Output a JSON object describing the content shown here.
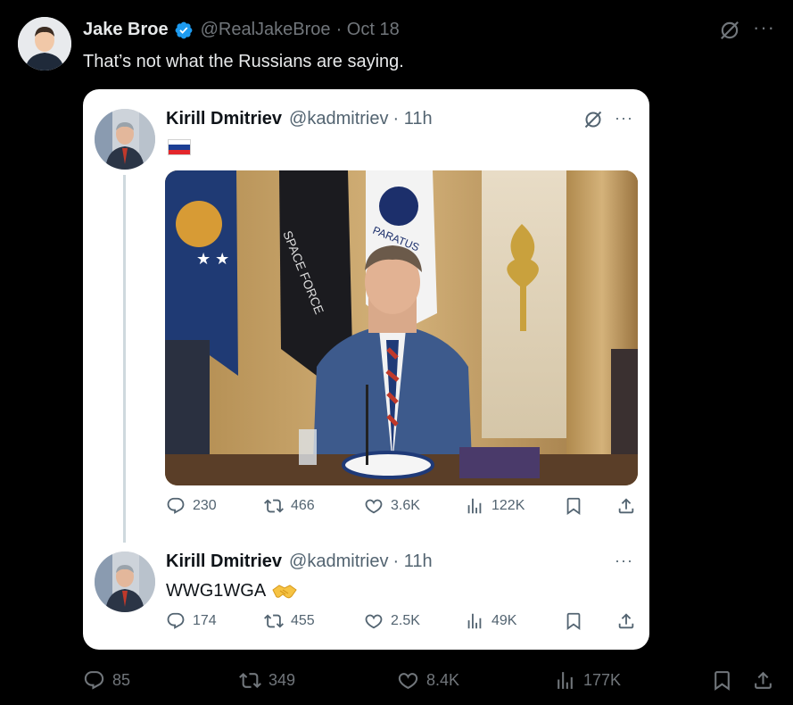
{
  "post": {
    "author_name": "Jake Broe",
    "handle": "@RealJakeBroe",
    "date": "· Oct 18",
    "text": "That’s not what the Russians are saying.",
    "more_label": "···",
    "stats": {
      "replies": "85",
      "reposts": "349",
      "likes": "8.4K",
      "views": "177K"
    }
  },
  "quoted": {
    "author_name": "Kirill Dmitriev",
    "handle": "@kadmitriev",
    "time": "· 11h",
    "more_label": "···",
    "flag_colors": [
      "#ffffff",
      "#1c3f94",
      "#e4262b"
    ],
    "stats": {
      "replies": "230",
      "reposts": "466",
      "likes": "3.6K",
      "views": "122K"
    }
  },
  "reply": {
    "author_name": "Kirill Dmitriev",
    "handle": "@kadmitriev",
    "time": "· 11h",
    "more_label": "···",
    "text": "WWG1WGA",
    "emoji": "handshake-emoji",
    "stats": {
      "replies": "174",
      "reposts": "455",
      "likes": "2.5K",
      "views": "49K"
    }
  },
  "colors": {
    "verified": "#1d9bf0",
    "muted_dark": "#71767b",
    "muted_light": "#536471"
  }
}
